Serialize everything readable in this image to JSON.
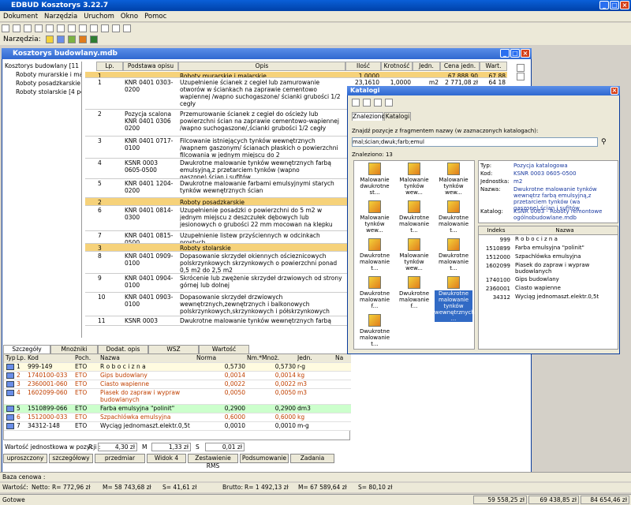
{
  "app_title": "EDBUD Kosztorys 3.22.7",
  "menu": [
    "Dokument",
    "Narzędzia",
    "Uruchom",
    "Okno",
    "Pomoc"
  ],
  "toolbar2_label": "Narzędzia:",
  "child_title": "Kosztorys budowlany.mdb",
  "tree": {
    "root": "Kosztorys budowlany [11 p",
    "items": [
      "Roboty murarskie i mal",
      "Roboty posadzkarskie",
      "Roboty stolarskie [4 pc"
    ]
  },
  "grid": {
    "headers": [
      "Lp.",
      "Podstawa opisu",
      "Opis",
      "Ilość",
      "Krotność",
      "Jedn.",
      "Cena jedn.",
      "Wart."
    ],
    "rows": [
      {
        "sec": true,
        "lp": "1",
        "basis": "",
        "desc": "Roboty murarskie i malarskie",
        "qty": "1,0000",
        "mult": "",
        "unit": "",
        "price": "67 888,90",
        "val": "67 88"
      },
      {
        "sec": false,
        "lp": "1",
        "basis": "KNR 0401 0303-0200",
        "desc": "Uzupełnienie ścianek z cegieł lub zamurowanie otworów w ściankach na zaprawie cementowo wapiennej /wapno suchogaszone/ ścianki grubości 1/2 cegły",
        "qty": "23,1610",
        "mult": "1,0000",
        "unit": "m2",
        "price": "2 771,08 zł",
        "val": "64 18"
      },
      {
        "sec": false,
        "lp": "2",
        "basis": "Pozycja scalona KNR 0401 0306 0200",
        "desc": "Przemurowanie ścianek z cegieł do ościeży lub powierzchni ścian na zaprawie cementowo-wapiennej /wapno suchogaszone/,ścianki grubości 1/2 cegły",
        "qty": "",
        "mult": "",
        "unit": "",
        "price": "",
        "val": ""
      },
      {
        "sec": false,
        "lp": "3",
        "basis": "KNR 0401 0717-0100",
        "desc": "Filcowanie istniejących tynków wewnętrznych /wapnem gaszonym/ ścianach płaskich o powierzchni filcowania w jednym miejscu do 2",
        "qty": "",
        "mult": "",
        "unit": "",
        "price": "",
        "val": ""
      },
      {
        "sec": false,
        "lp": "4",
        "basis": "KSNR 0003 0605-0500",
        "desc": "Dwukrotne malowanie tynków wewnętrznych farbą emulsyjną,z przetarciem tynków (wapno gaszone),ścian i sufitów",
        "qty": "",
        "mult": "",
        "unit": "",
        "price": "",
        "val": ""
      },
      {
        "sec": false,
        "lp": "5",
        "basis": "KNR 0401 1204-0200",
        "desc": "Dwukrotne malowanie farbami emulsyjnymi starych tynków wewnętrznych ścian",
        "qty": "",
        "mult": "",
        "unit": "",
        "price": "",
        "val": ""
      },
      {
        "sec": true,
        "lp": "2",
        "basis": "",
        "desc": "Roboty posadzkarskie",
        "qty": "",
        "mult": "",
        "unit": "",
        "price": "",
        "val": ""
      },
      {
        "sec": false,
        "lp": "6",
        "basis": "KNR 0401 0814-0300",
        "desc": "Uzupełnienie posadzki o powierzchni do 5 m2 w jednym miejscu z deszczułek dębowych lub jesionowych o grubości 22 mm mocowan na klepku",
        "qty": "",
        "mult": "",
        "unit": "",
        "price": "",
        "val": ""
      },
      {
        "sec": false,
        "lp": "7",
        "basis": "KNR 0401 0815-0500",
        "desc": "Uzupełnienie listew przyściennych w odcinkach prostych",
        "qty": "",
        "mult": "",
        "unit": "",
        "price": "",
        "val": ""
      },
      {
        "sec": true,
        "lp": "3",
        "basis": "",
        "desc": "Roboty stolarskie",
        "qty": "",
        "mult": "",
        "unit": "",
        "price": "",
        "val": ""
      },
      {
        "sec": false,
        "lp": "8",
        "basis": "KNR 0401 0909-0100",
        "desc": "Dopasowanie skrzydeł okiennych ościeznicowych polskrzynkowych skrzynkowych o powierzchni ponad 0,5 m2 do 2,5 m2",
        "qty": "",
        "mult": "",
        "unit": "",
        "price": "",
        "val": ""
      },
      {
        "sec": false,
        "lp": "9",
        "basis": "KNR 0401 0904-0100",
        "desc": "Skrócenie lub zwężenie skrzydeł drzwiowych od strony górnej lub dolnej",
        "qty": "",
        "mult": "",
        "unit": "",
        "price": "",
        "val": ""
      },
      {
        "sec": false,
        "lp": "10",
        "basis": "KNR 0401 0903-0100",
        "desc": "Dopasowanie skrzydeł drzwiowych wewnętrznych,zewnętrznych i balkonowych polskrzynkowych,skrzynkowych i półskrzynkowych",
        "qty": "",
        "mult": "",
        "unit": "",
        "price": "",
        "val": ""
      },
      {
        "sec": false,
        "lp": "11",
        "basis": "KSNR 0003 0605-0500",
        "desc": "Dwukrotne malowanie tynków wewnętrznych farbą emulsyjną,z",
        "qty": "",
        "mult": "",
        "unit": "",
        "price": "",
        "val": ""
      }
    ]
  },
  "bottom_tabs": [
    "Szczegóły",
    "Mnożniki",
    "Dodat. opis",
    "WSZ",
    "Wartość"
  ],
  "bottom_headers": [
    "Typ",
    "Lp.",
    "Kod",
    "Poch.",
    "Nazwa",
    "Norma",
    "Nm.*Mnoż.",
    "Jedn.",
    "Na"
  ],
  "bottom_rows": [
    {
      "lp": "1",
      "kod": "999-149",
      "poch": "ETO",
      "nazwa": "R o b o c i z n a",
      "norma": "0,5730",
      "nm": "0,5730",
      "jedn": "r-g",
      "color": "#000000",
      "bg": "#fffbe0"
    },
    {
      "lp": "2",
      "kod": "1740100-033",
      "poch": "ETO",
      "nazwa": "Gips budowlany",
      "norma": "0,0014",
      "nm": "0,0014",
      "jedn": "kg",
      "color": "#c04000",
      "bg": "#ffffff"
    },
    {
      "lp": "3",
      "kod": "2360001-060",
      "poch": "ETO",
      "nazwa": "Ciasto wapienne",
      "norma": "0,0022",
      "nm": "0,0022",
      "jedn": "m3",
      "color": "#c04000",
      "bg": "#ffffff"
    },
    {
      "lp": "4",
      "kod": "1602099-060",
      "poch": "ETO",
      "nazwa": "Piasek do zapraw i wypraw budowlanych",
      "norma": "0,0050",
      "nm": "0,0050",
      "jedn": "m3",
      "color": "#c04000",
      "bg": "#ffffff"
    },
    {
      "lp": "5",
      "kod": "1510899-066",
      "poch": "ETO",
      "nazwa": "Farba emulsyjna \"polinit\"",
      "norma": "0,2900",
      "nm": "0,2900",
      "jedn": "dm3",
      "color": "#000000",
      "bg": "#ccffcc"
    },
    {
      "lp": "6",
      "kod": "1512000-033",
      "poch": "ETO",
      "nazwa": "Szpachlówka emulsyjna",
      "norma": "0,6000",
      "nm": "0,6000",
      "jedn": "kg",
      "color": "#c04000",
      "bg": "#ffffff"
    },
    {
      "lp": "7",
      "kod": "34312-148",
      "poch": "ETO",
      "nazwa": "Wyciąg jednomaszt.elektr.0,5t",
      "norma": "0,0010",
      "nm": "0,0010",
      "jedn": "m-g",
      "color": "#000000",
      "bg": "#ffffff"
    }
  ],
  "bottom_footer": {
    "label": "Wartość jednostkowa w pozycji :",
    "r_label": "R",
    "r": "4,30 zł",
    "m_label": "M",
    "m": "1,33 zł",
    "s_label": "S",
    "s": "0,01 zł"
  },
  "bottom_buttons": [
    "uproszczony",
    "szczegółowy",
    "przedmiar",
    "Widok 4",
    "Zestawienie RMS",
    "Podsumowanie",
    "Zadania"
  ],
  "katalog": {
    "title": "Katalogi",
    "tabs": [
      "Znaleziono",
      "Katalogi"
    ],
    "find_label": "Znajdź pozycje z fragmentem nazwy (w zaznaczonych katalogach):",
    "find_value": "mal;ścian;dwuk;farb;emul",
    "found": "Znaleziono: 13",
    "items": [
      "Malowanie dwukrotne st...",
      "Malowanie tynków wew...",
      "Malowanie tynków wew...",
      "Malowanie tynków wew...",
      "Dwukrotne malowanie t...",
      "Dwukrotne malowanie t...",
      "Dwukrotne malowanie t...",
      "Malowanie tynków wew...",
      "Dwukrotne malowanie t...",
      "Dwukrotne malowanie f...",
      "Dwukrotne malowanie f...",
      "Dwukrotne malowanie tynków wewnętrznych ...",
      "Dwukrotne malowanie t..."
    ],
    "props": [
      {
        "k": "Typ:",
        "v": "Pozycja katalogowa"
      },
      {
        "k": "Kod:",
        "v": "KSNR 0003 0605-0500"
      },
      {
        "k": "Jednostka:",
        "v": "m2"
      },
      {
        "k": "Nazwa:",
        "v": "Dwukrotne malowanie tynków wewnętrz farbą emulsyjną,z przetarciem tynków (wa gaszone),ścian i sufitów"
      },
      {
        "k": "Katalog:",
        "v": "KSNR 0003 - Roboty remontowe ogólnobudowlane.mdb"
      }
    ],
    "idx_headers": [
      "Indeks",
      "Nazwa"
    ],
    "idx_rows": [
      {
        "i": "999",
        "n": "R o b o c i z n a"
      },
      {
        "i": "1510899",
        "n": "Farba emulsyjna \"polinit\""
      },
      {
        "i": "1512000",
        "n": "Szpachlówka emulsyjna"
      },
      {
        "i": "1602099",
        "n": "Piasek do zapraw i wypraw budowlanych"
      },
      {
        "i": "1740100",
        "n": "Gips budowlany"
      },
      {
        "i": "2360001",
        "n": "Ciasto wapienne"
      },
      {
        "i": "34312",
        "n": "Wyciąg jednomaszt.elektr.0,5t"
      }
    ]
  },
  "base_label": "Baza cenowa :",
  "wartosc": {
    "label": "Wartość:",
    "netto": "Netto:",
    "r": "R= 772,96 zł",
    "m": "M= 58 743,68 zł",
    "s": "S= 41,61 zł",
    "brutto": "Brutto:",
    "br": "R= 1 492,13 zł",
    "bm": "M= 67 589,64 zł",
    "bs": "S= 80,10 zł"
  },
  "status": {
    "ready": "Gotowe",
    "v1": "59 558,25 zł",
    "v2": "69 438,85 zł",
    "v3": "84 654,46 zł"
  }
}
